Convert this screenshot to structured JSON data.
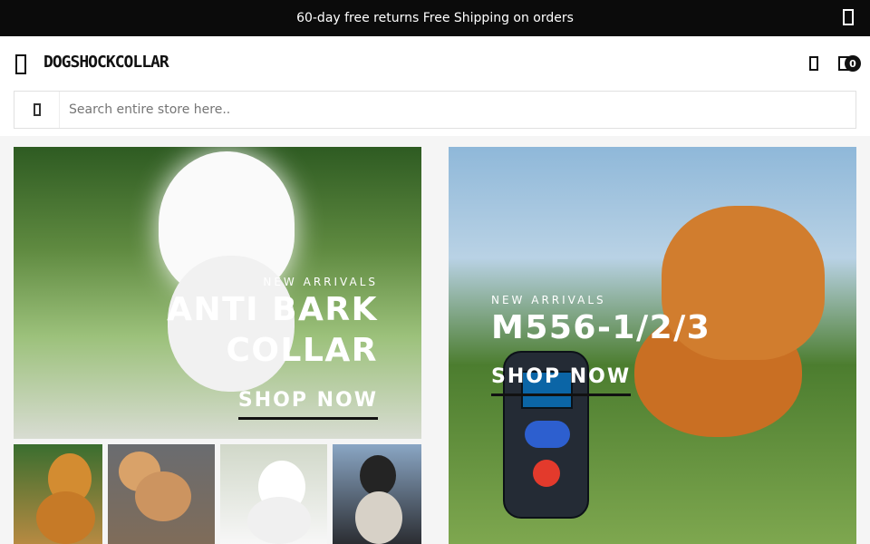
{
  "topbar": {
    "message": "60-day free returns Free Shipping on orders",
    "close_icon": "close-icon"
  },
  "header": {
    "logo": "DOGSHOCKCOLLAR",
    "menu_icon": "menu-icon",
    "user_icon": "user-icon",
    "cart_icon": "cart-icon",
    "cart_count": "0"
  },
  "search": {
    "placeholder": "Search entire store here..",
    "icon": "search-icon"
  },
  "banners": {
    "left": {
      "kicker": "NEW ARRIVALS",
      "title_line1": "ANTI BARK",
      "title_line2": "COLLAR",
      "button": "SHOP NOW"
    },
    "right": {
      "kicker": "NEW ARRIVALS",
      "title": "M556-1/2/3",
      "button": "SHOP NOW"
    }
  },
  "thumbnails": {
    "items": [
      {
        "name": "thumbnail-golden-retriever"
      },
      {
        "name": "thumbnail-shiba-inu"
      },
      {
        "name": "thumbnail-westie"
      },
      {
        "name": "thumbnail-husky"
      }
    ]
  },
  "colors": {
    "topbar_bg": "#0b0b0b",
    "text_dark": "#111111",
    "accent_white": "#ffffff"
  }
}
